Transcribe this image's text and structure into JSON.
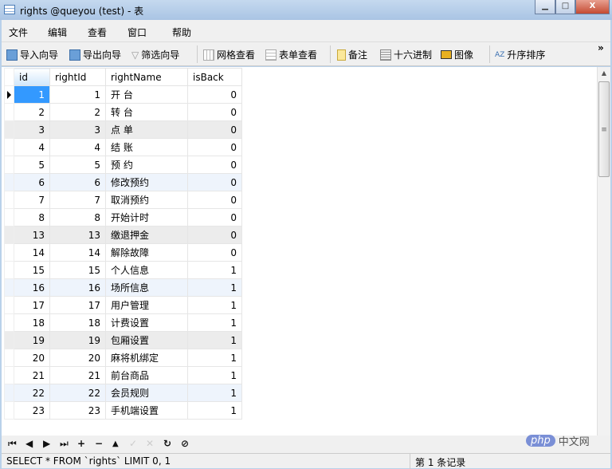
{
  "window": {
    "title": "rights @queyou (test) - 表",
    "minimize": "▁",
    "maximize": "□",
    "close": "X"
  },
  "menu": [
    "文件",
    "编辑",
    "查看",
    "窗口",
    "帮助"
  ],
  "toolbar": {
    "import": "导入向导",
    "export": "导出向导",
    "filter": "筛选向导",
    "grid_view": "网格查看",
    "form_view": "表单查看",
    "memo": "备注",
    "hex": "十六进制",
    "image": "图像",
    "sort_asc": "升序排序",
    "more": "»"
  },
  "columns": [
    "id",
    "rightId",
    "rightName",
    "isBack"
  ],
  "rows": [
    [
      1,
      1,
      "开 台",
      0
    ],
    [
      2,
      2,
      "转 台",
      0
    ],
    [
      3,
      3,
      "点 单",
      0
    ],
    [
      4,
      4,
      "结 账",
      0
    ],
    [
      5,
      5,
      "预 约",
      0
    ],
    [
      6,
      6,
      "修改预约",
      0
    ],
    [
      7,
      7,
      "取消预约",
      0
    ],
    [
      8,
      8,
      "开始计时",
      0
    ],
    [
      13,
      13,
      "缴退押金",
      0
    ],
    [
      14,
      14,
      "解除故障",
      0
    ],
    [
      15,
      15,
      "个人信息",
      1
    ],
    [
      16,
      16,
      "场所信息",
      1
    ],
    [
      17,
      17,
      "用户管理",
      1
    ],
    [
      18,
      18,
      "计费设置",
      1
    ],
    [
      19,
      19,
      "包厢设置",
      1
    ],
    [
      20,
      20,
      "麻将机绑定",
      1
    ],
    [
      21,
      21,
      "前台商品",
      1
    ],
    [
      22,
      22,
      "会员规则",
      1
    ],
    [
      23,
      23,
      "手机端设置",
      1
    ]
  ],
  "navigator": {
    "first": "⏮",
    "prev": "◀",
    "next": "▶",
    "last": "⏭",
    "add": "+",
    "delete": "−",
    "up": "▲",
    "apply": "✓",
    "cancel": "✕",
    "refresh": "↻",
    "stop": "⊘"
  },
  "status": {
    "sql": "SELECT * FROM `rights` LIMIT 0, 1",
    "record": "第 1 条记录"
  },
  "watermark": {
    "php": "php",
    "cn": "中文网"
  }
}
